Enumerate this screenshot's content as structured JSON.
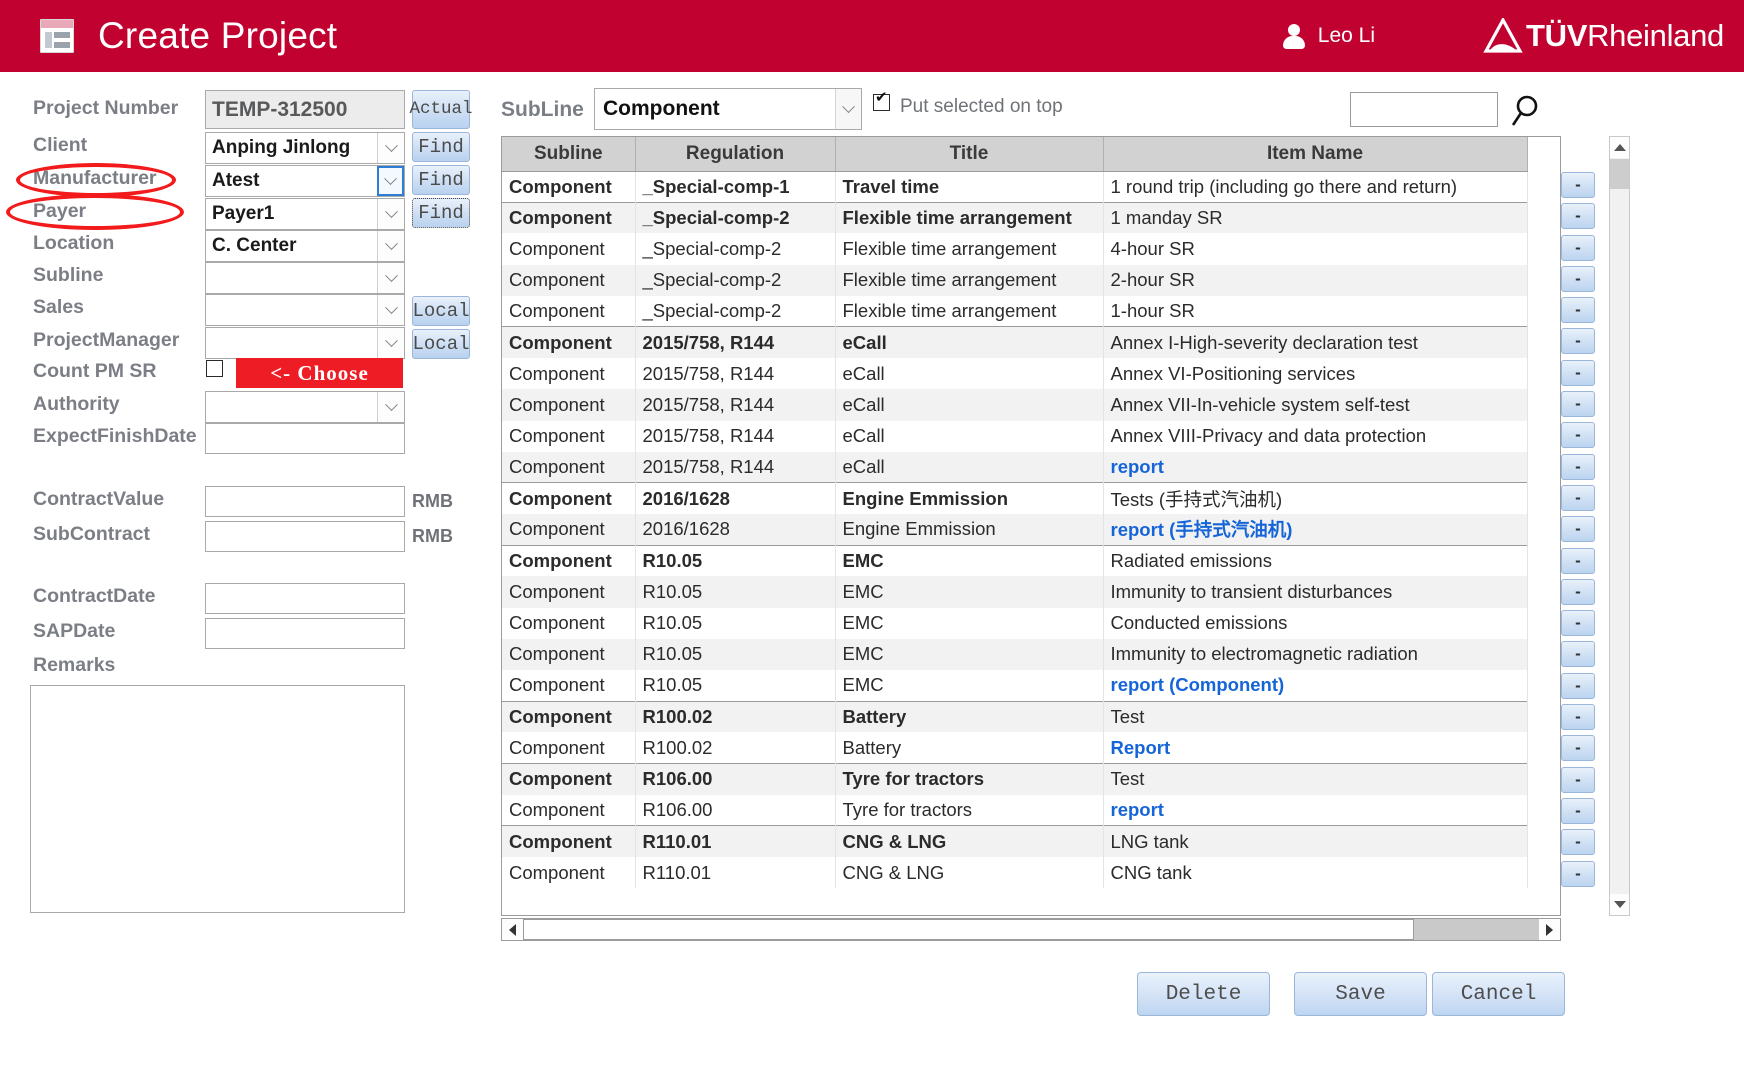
{
  "header": {
    "title": "Create Project",
    "user_name": "Leo Li",
    "logo_bold": "TÜV",
    "logo_regular": "Rheinland",
    "doc_icon": "document-icon",
    "user_icon": "user-avatar-icon"
  },
  "form": {
    "project_number": {
      "label": "Project Number",
      "value": "TEMP-312500",
      "button": "Actual"
    },
    "client": {
      "label": "Client",
      "value": "Anping Jinlong",
      "button": "Find"
    },
    "manufacturer": {
      "label": "Manufacturer",
      "value": "Atest",
      "button": "Find"
    },
    "payer": {
      "label": "Payer",
      "value": "Payer1",
      "button": "Find"
    },
    "location": {
      "label": "Location",
      "value": "C. Center"
    },
    "subline": {
      "label": "Subline",
      "value": ""
    },
    "sales": {
      "label": "Sales",
      "value": "",
      "button": "Local"
    },
    "project_manager": {
      "label": "ProjectManager",
      "value": "",
      "button": "Local"
    },
    "count_pm_sr": {
      "label": "Count PM SR",
      "checked": false,
      "choose_button": "<-  Choose"
    },
    "authority": {
      "label": "Authority",
      "value": ""
    },
    "expect_finish": {
      "label": "ExpectFinishDate",
      "value": ""
    },
    "contract_value": {
      "label": "ContractValue",
      "value": "",
      "unit": "RMB"
    },
    "sub_contract": {
      "label": "SubContract",
      "value": "",
      "unit": "RMB"
    },
    "contract_date": {
      "label": "ContractDate",
      "value": ""
    },
    "sap_date": {
      "label": "SAPDate",
      "value": ""
    },
    "remarks": {
      "label": "Remarks",
      "value": ""
    }
  },
  "annotations": {
    "highlight_color": "#f21a1a",
    "circled_labels": [
      "Manufacturer",
      "Payer"
    ]
  },
  "toolbar": {
    "subline_label": "SubLine",
    "subline_value": "Component",
    "put_selected_on_top_label": "Put selected on top",
    "put_selected_on_top_checked": true,
    "search_value": "",
    "search_icon": "magnifier-icon"
  },
  "table": {
    "columns": [
      "Subline",
      "Regulation",
      "Title",
      "Item Name"
    ],
    "rows": [
      {
        "group_start": true,
        "subline": "Component",
        "regulation": "_Special-comp-1",
        "title": "Travel time",
        "item": "1 round trip (including go there and return)",
        "item_kind": "text",
        "remove": "-"
      },
      {
        "group_start": true,
        "subline": "Component",
        "regulation": "_Special-comp-2",
        "title": "Flexible time arrangement",
        "item": "1 manday SR",
        "item_kind": "text",
        "remove": "-"
      },
      {
        "group_start": false,
        "subline": "Component",
        "regulation": "_Special-comp-2",
        "title": "Flexible time arrangement",
        "item": "4-hour SR",
        "item_kind": "text",
        "remove": "-"
      },
      {
        "group_start": false,
        "subline": "Component",
        "regulation": "_Special-comp-2",
        "title": "Flexible time arrangement",
        "item": "2-hour SR",
        "item_kind": "text",
        "remove": "-"
      },
      {
        "group_start": false,
        "subline": "Component",
        "regulation": "_Special-comp-2",
        "title": "Flexible time arrangement",
        "item": "1-hour SR",
        "item_kind": "text",
        "remove": "-"
      },
      {
        "group_start": true,
        "subline": "Component",
        "regulation": "2015/758, R144",
        "title": "eCall",
        "item": "Annex I-High-severity declaration test",
        "item_kind": "text",
        "remove": "-"
      },
      {
        "group_start": false,
        "subline": "Component",
        "regulation": "2015/758, R144",
        "title": "eCall",
        "item": "Annex VI-Positioning services",
        "item_kind": "text",
        "remove": "-"
      },
      {
        "group_start": false,
        "subline": "Component",
        "regulation": "2015/758, R144",
        "title": "eCall",
        "item": "Annex VII-In-vehicle system self-test",
        "item_kind": "text",
        "remove": "-"
      },
      {
        "group_start": false,
        "subline": "Component",
        "regulation": "2015/758, R144",
        "title": "eCall",
        "item": "Annex VIII-Privacy and data protection",
        "item_kind": "text",
        "remove": "-"
      },
      {
        "group_start": false,
        "subline": "Component",
        "regulation": "2015/758, R144",
        "title": "eCall",
        "item": "report",
        "item_kind": "link",
        "remove": "-"
      },
      {
        "group_start": true,
        "subline": "Component",
        "regulation": "2016/1628",
        "title": "Engine Emmission",
        "item": "Tests (手持式汽油机)",
        "item_kind": "text",
        "remove": "-"
      },
      {
        "group_start": false,
        "subline": "Component",
        "regulation": "2016/1628",
        "title": "Engine Emmission",
        "item": "report (手持式汽油机)",
        "item_kind": "link",
        "remove": "-"
      },
      {
        "group_start": true,
        "subline": "Component",
        "regulation": "R10.05",
        "title": "EMC",
        "item": "Radiated emissions",
        "item_kind": "text",
        "remove": "-"
      },
      {
        "group_start": false,
        "subline": "Component",
        "regulation": "R10.05",
        "title": "EMC",
        "item": "Immunity to transient disturbances",
        "item_kind": "text",
        "remove": "-"
      },
      {
        "group_start": false,
        "subline": "Component",
        "regulation": "R10.05",
        "title": "EMC",
        "item": "Conducted emissions",
        "item_kind": "text",
        "remove": "-"
      },
      {
        "group_start": false,
        "subline": "Component",
        "regulation": "R10.05",
        "title": "EMC",
        "item": "Immunity to electromagnetic radiation",
        "item_kind": "text",
        "remove": "-"
      },
      {
        "group_start": false,
        "subline": "Component",
        "regulation": "R10.05",
        "title": "EMC",
        "item": "report (Component)",
        "item_kind": "link",
        "remove": "-"
      },
      {
        "group_start": true,
        "subline": "Component",
        "regulation": "R100.02",
        "title": "Battery",
        "item": "Test",
        "item_kind": "text",
        "remove": "-"
      },
      {
        "group_start": false,
        "subline": "Component",
        "regulation": "R100.02",
        "title": "Battery",
        "item": "Report",
        "item_kind": "link",
        "remove": "-"
      },
      {
        "group_start": true,
        "subline": "Component",
        "regulation": "R106.00",
        "title": "Tyre for tractors",
        "item": "Test",
        "item_kind": "text",
        "remove": "-"
      },
      {
        "group_start": false,
        "subline": "Component",
        "regulation": "R106.00",
        "title": "Tyre for tractors",
        "item": "report",
        "item_kind": "link",
        "remove": "-"
      },
      {
        "group_start": true,
        "subline": "Component",
        "regulation": "R110.01",
        "title": "CNG & LNG",
        "item": "LNG tank",
        "item_kind": "text",
        "remove": "-"
      },
      {
        "group_start": false,
        "subline": "Component",
        "regulation": "R110.01",
        "title": "CNG & LNG",
        "item": "CNG tank",
        "item_kind": "text",
        "remove": "-"
      }
    ]
  },
  "actions": {
    "delete_label": "Delete",
    "save_label": "Save",
    "cancel_label": "Cancel"
  },
  "colors": {
    "brand_red": "#c10230",
    "accent_red": "#ee1c25",
    "link_blue": "#1565d8",
    "label_gray": "#7b7f85"
  }
}
